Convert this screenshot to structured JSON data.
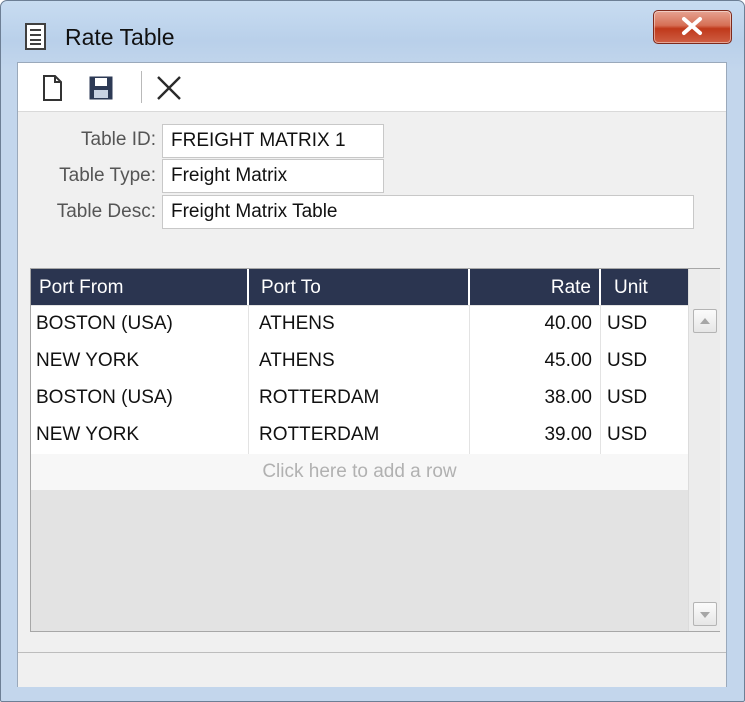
{
  "window": {
    "title": "Rate Table",
    "title_icon": "table-icon",
    "close_icon": "close-icon"
  },
  "toolbar": {
    "new_icon": "new-document-icon",
    "save_icon": "save-icon",
    "delete_icon": "delete-x-icon"
  },
  "form": {
    "table_id_label": "Table ID:",
    "table_id_value": "FREIGHT MATRIX 1",
    "table_type_label": "Table Type:",
    "table_type_value": "Freight Matrix",
    "table_desc_label": "Table Desc:",
    "table_desc_value": "Freight Matrix Table"
  },
  "grid": {
    "columns": [
      "Port From",
      "Port To",
      "Rate",
      "Unit"
    ],
    "rows": [
      {
        "port_from": "BOSTON (USA)",
        "port_to": "ATHENS",
        "rate": "40.00",
        "unit": "USD"
      },
      {
        "port_from": "NEW YORK",
        "port_to": "ATHENS",
        "rate": "45.00",
        "unit": "USD"
      },
      {
        "port_from": "BOSTON (USA)",
        "port_to": "ROTTERDAM",
        "rate": "38.00",
        "unit": "USD"
      },
      {
        "port_from": "NEW YORK",
        "port_to": "ROTTERDAM",
        "rate": "39.00",
        "unit": "USD"
      }
    ],
    "add_row_text": "Click here to add a row"
  },
  "colors": {
    "header_bg": "#2b3550",
    "close_button": "#c7452a",
    "window_frame": "#b9d0ea"
  }
}
